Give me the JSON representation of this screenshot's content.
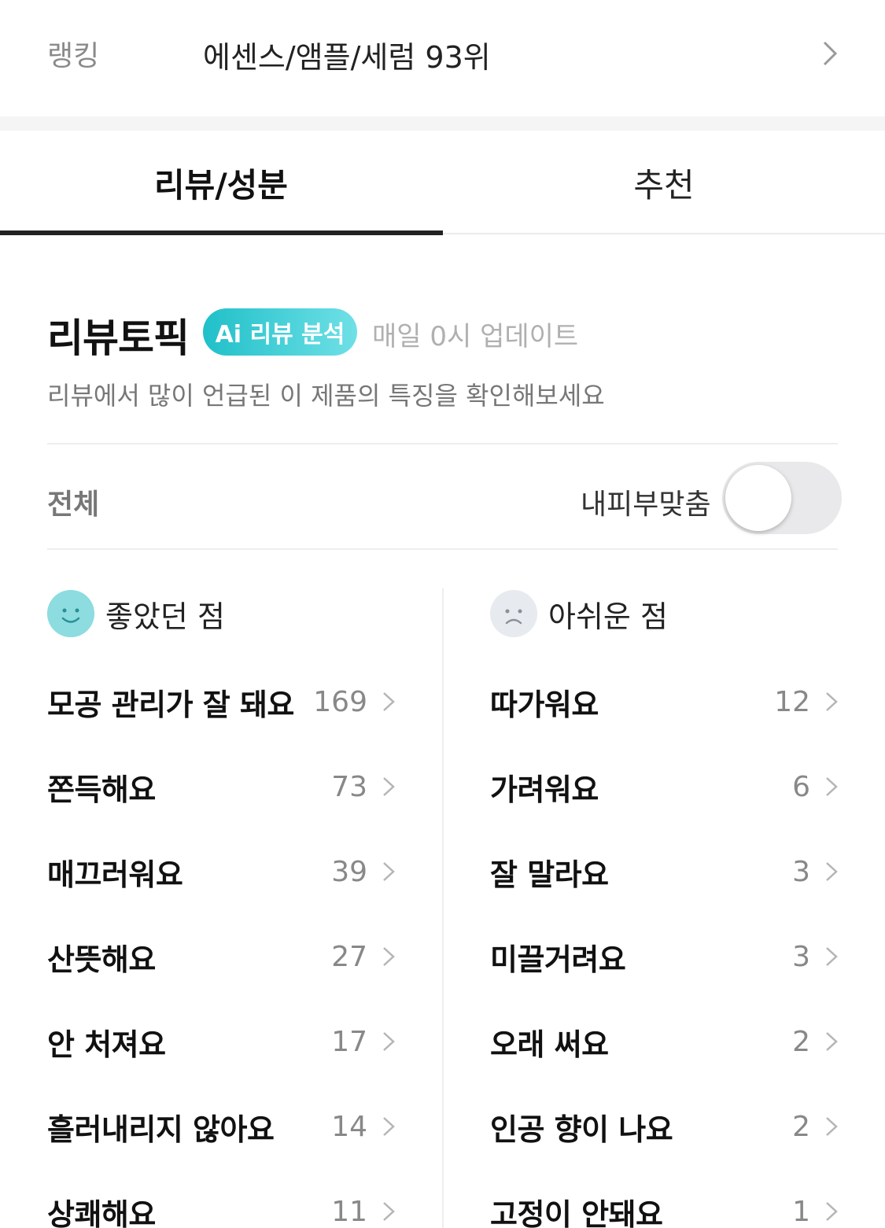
{
  "ranking": {
    "label": "랭킹",
    "value": "에센스/앰플/세럼 93위"
  },
  "tabs": [
    {
      "label": "리뷰/성분",
      "active": true
    },
    {
      "label": "추천",
      "active": false
    }
  ],
  "topic": {
    "title": "리뷰토픽",
    "badge": "Ai 리뷰 분석",
    "update": "매일 0시 업데이트",
    "subtitle": "리뷰에서 많이 언급된 이 제품의 특징을 확인해보세요"
  },
  "filter": {
    "all": "전체",
    "skin_match": "내피부맞춤",
    "skin_match_on": false
  },
  "good": {
    "title": "좋았던 점",
    "items": [
      {
        "label": "모공 관리가 잘 돼요",
        "count": "169"
      },
      {
        "label": "쫀득해요",
        "count": "73"
      },
      {
        "label": "매끄러워요",
        "count": "39"
      },
      {
        "label": "산뜻해요",
        "count": "27"
      },
      {
        "label": "안 처져요",
        "count": "17"
      },
      {
        "label": "흘러내리지 않아요",
        "count": "14"
      },
      {
        "label": "상쾌해요",
        "count": "11"
      }
    ]
  },
  "bad": {
    "title": "아쉬운 점",
    "items": [
      {
        "label": "따가워요",
        "count": "12"
      },
      {
        "label": "가려워요",
        "count": "6"
      },
      {
        "label": "잘 말라요",
        "count": "3"
      },
      {
        "label": "미끌거려요",
        "count": "3"
      },
      {
        "label": "오래 써요",
        "count": "2"
      },
      {
        "label": "인공 향이 나요",
        "count": "2"
      },
      {
        "label": "고정이 안돼요",
        "count": "1"
      }
    ]
  },
  "colors": {
    "accent_teal": "#20c0c9",
    "good_face": "#8cdce0",
    "bad_face": "#e7ebef"
  }
}
